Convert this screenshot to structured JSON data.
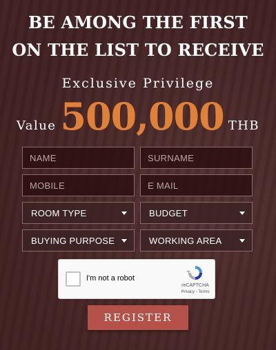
{
  "headline": {
    "line1": "BE AMONG THE FIRST",
    "line2": "ON THE LIST TO RECEIVE"
  },
  "offer": {
    "exclusive": "Exclusive Privilege",
    "value_label": "Value",
    "amount": "500,000",
    "currency": "THB",
    "accent_color": "#e0813a"
  },
  "form": {
    "name_placeholder": "NAME",
    "surname_placeholder": "SURNAME",
    "mobile_placeholder": "MOBILE",
    "email_placeholder": "E MAIL",
    "room_type": "ROOM TYPE",
    "budget": "BUDGET",
    "buying_purpose": "BUYING PURPOSE",
    "working_area": "WORKING AREA"
  },
  "captcha": {
    "label": "I'm not a robot",
    "brand": "reCAPTCHA",
    "links": "Privacy - Terms",
    "icon": "recaptcha-logo-icon"
  },
  "submit": {
    "label": "REGISTER",
    "color": "#b4524a"
  }
}
